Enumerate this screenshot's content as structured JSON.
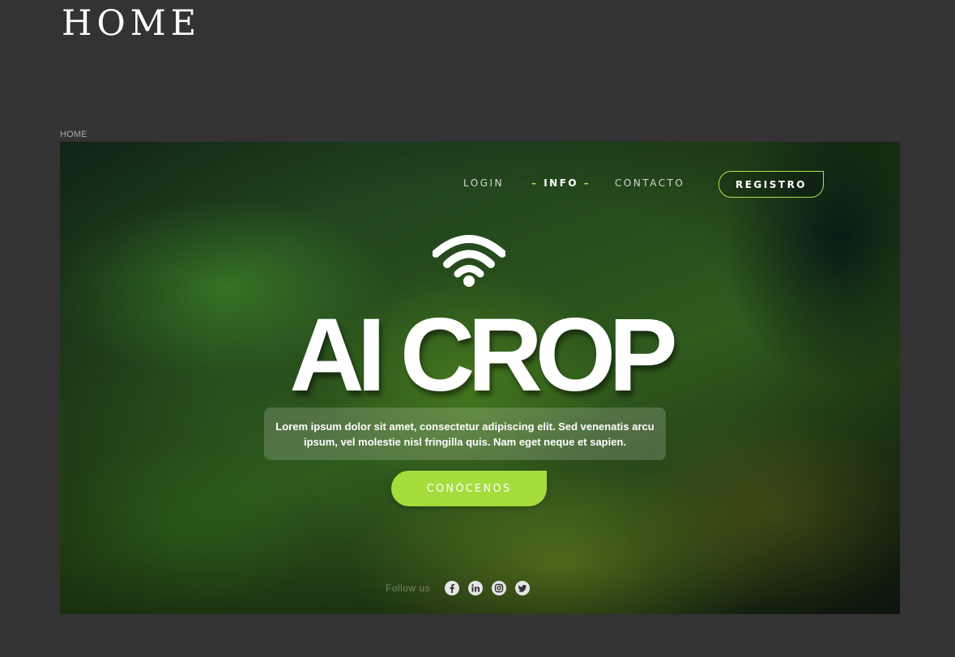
{
  "page": {
    "title": "HOME",
    "frame_label": "HOME"
  },
  "nav": {
    "login": "LOGIN",
    "info": "INFO",
    "info_dash": "–",
    "contacto": "CONTACTO",
    "registro": "REGISTRO"
  },
  "hero": {
    "brand": "AI CROP",
    "description": "Lorem ipsum dolor sit amet, consectetur adipiscing elit. Sed venenatis arcu ipsum, vel molestie nisl fringilla quis. Nam eget neque et sapien.",
    "cta": "CONÓCENOS"
  },
  "social": {
    "label": "Follow us",
    "icons": [
      "facebook-icon",
      "linkedin-icon",
      "instagram-icon",
      "twitter-icon"
    ]
  },
  "colors": {
    "background": "#333333",
    "accent": "#a4dd3c",
    "accent_border": "#b5e04a"
  }
}
